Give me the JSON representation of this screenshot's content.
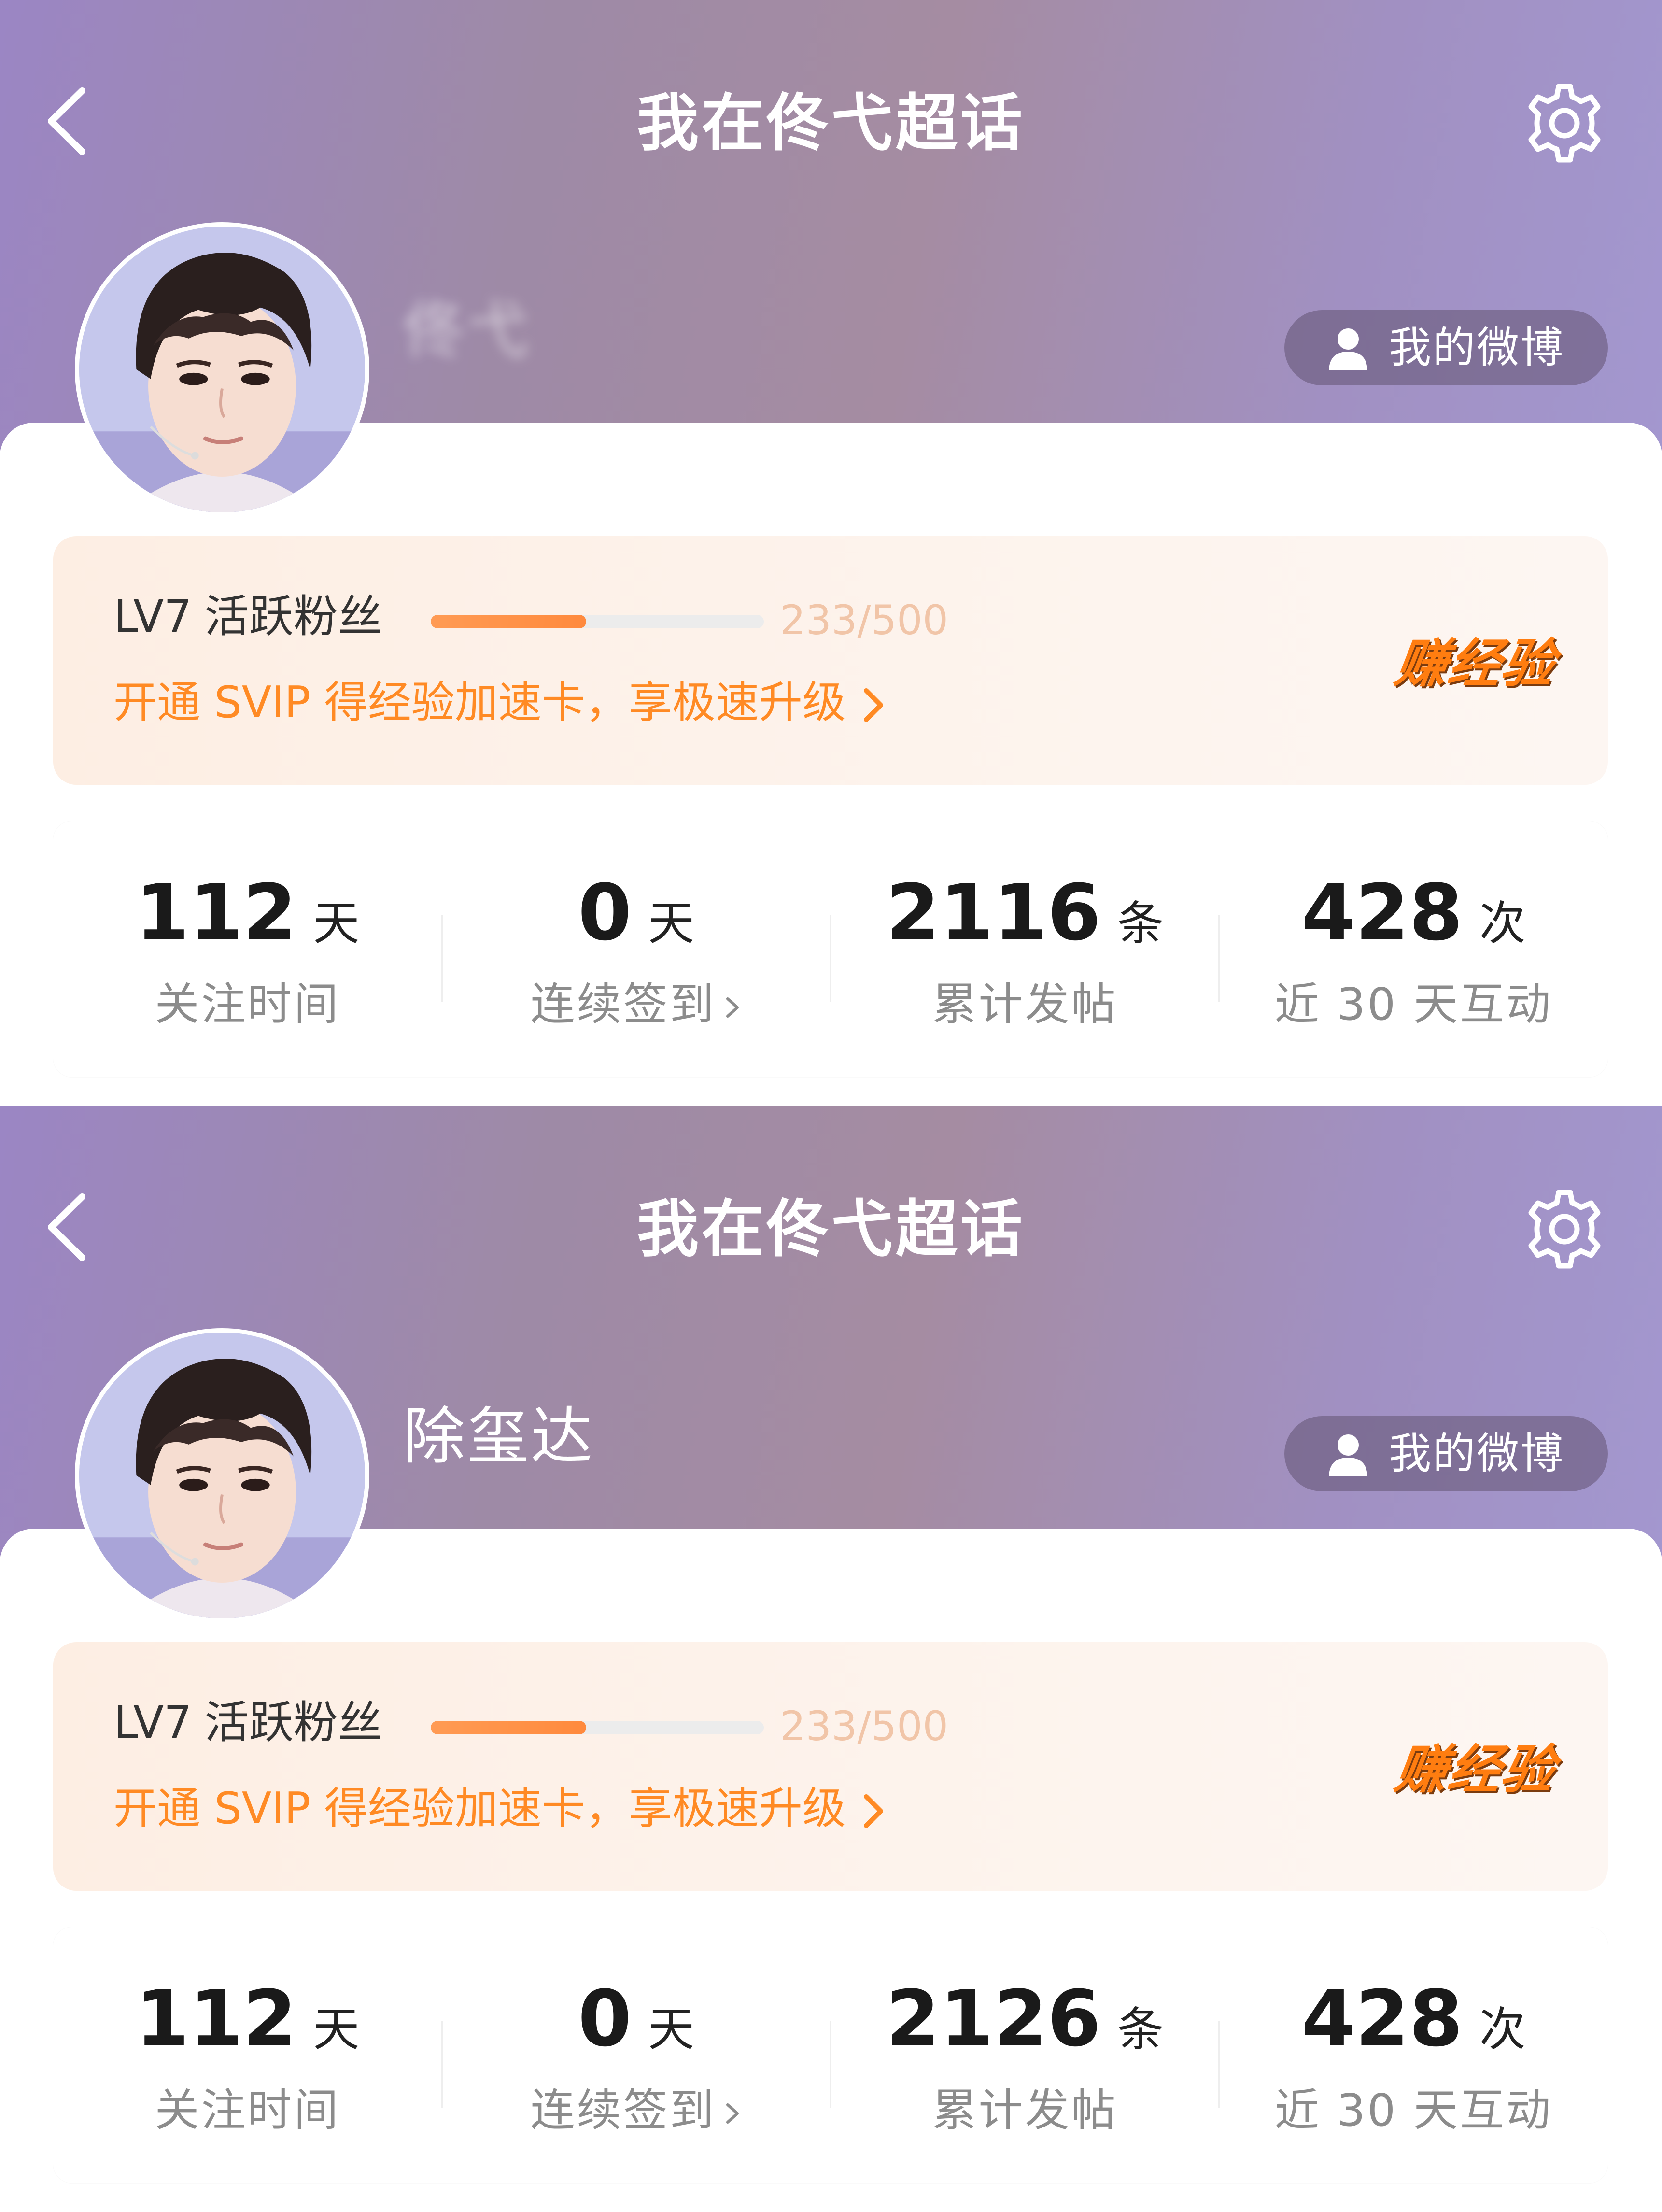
{
  "panels": [
    {
      "header": {
        "title": "我在佟弋超话"
      },
      "profile": {
        "username": "佟弋",
        "my_weibo_label": "我的微博"
      },
      "level_card": {
        "level": "LV7",
        "level_name": "活跃粉丝",
        "progress_text": "233/500",
        "progress_fraction": 0.466,
        "svip_text": "开通 SVIP 得经验加速卡，享极速升级",
        "earn_label": "赚经验"
      },
      "stats": [
        {
          "value": "112",
          "unit": "天",
          "label": "关注时间"
        },
        {
          "value": "0",
          "unit": "天",
          "label": "连续签到"
        },
        {
          "value": "2116",
          "unit": "条",
          "label": "累计发帖"
        },
        {
          "value": "428",
          "unit": "次",
          "label": "近 30 天互动"
        }
      ]
    },
    {
      "header": {
        "title": "我在佟弋超话"
      },
      "profile": {
        "username": "除玺达",
        "my_weibo_label": "我的微博"
      },
      "level_card": {
        "level": "LV7",
        "level_name": "活跃粉丝",
        "progress_text": "233/500",
        "progress_fraction": 0.466,
        "svip_text": "开通 SVIP 得经验加速卡，享极速升级",
        "earn_label": "赚经验"
      },
      "stats": [
        {
          "value": "112",
          "unit": "天",
          "label": "关注时间"
        },
        {
          "value": "0",
          "unit": "天",
          "label": "连续签到"
        },
        {
          "value": "2126",
          "unit": "条",
          "label": "累计发帖"
        },
        {
          "value": "428",
          "unit": "次",
          "label": "近 30 天互动"
        }
      ]
    }
  ],
  "icons": {
    "back": "chevron-left-icon",
    "settings": "gear-icon",
    "user": "user-icon",
    "chevron": "chevron-right-icon"
  },
  "colors": {
    "accent_orange": "#ff8a24",
    "progress_fill": "#ff8a3d",
    "hero_purple": "#a08cbc"
  }
}
